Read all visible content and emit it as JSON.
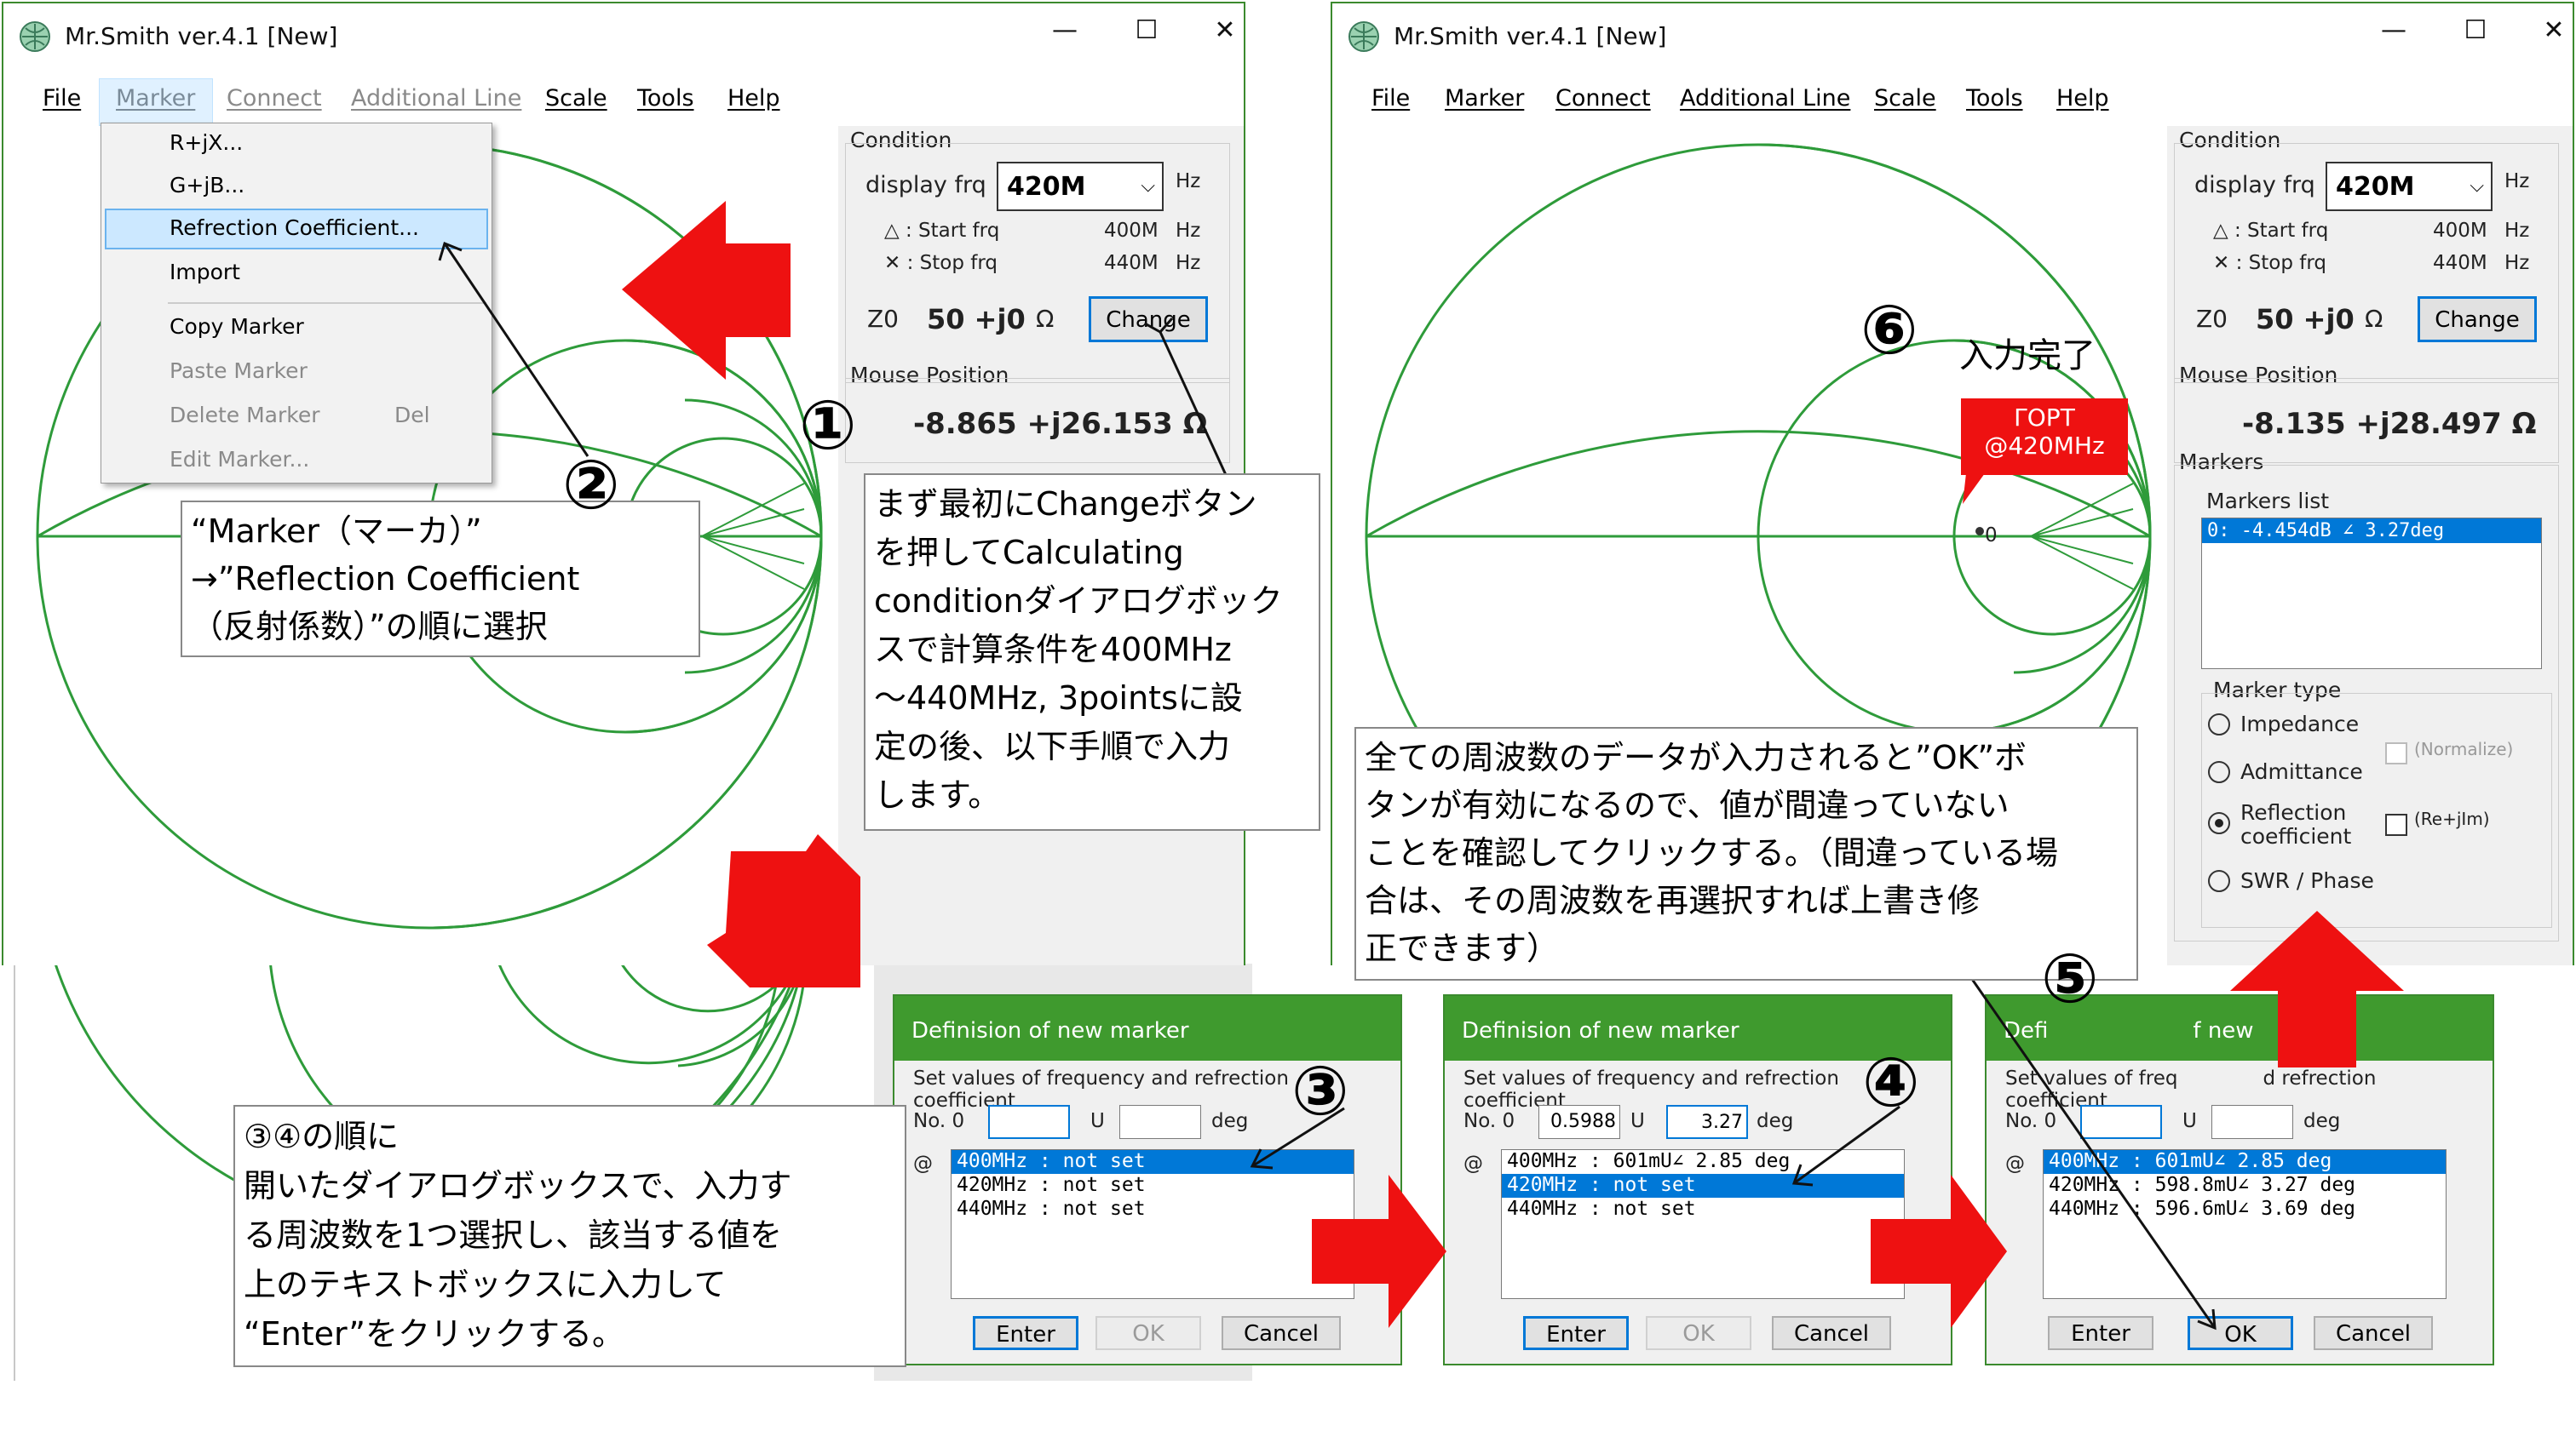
{
  "app": {
    "title": "Mr.Smith ver.4.1 [New]",
    "minimize": "—",
    "maximize": "☐",
    "close": "✕"
  },
  "menubar": {
    "file": "File",
    "marker": "Marker",
    "connect": "Connect",
    "additional_line": "Additional Line",
    "scale": "Scale",
    "tools": "Tools",
    "help": "Help"
  },
  "marker_menu": {
    "items": [
      "R+jX...",
      "G+jB...",
      "Refrection Coefficient...",
      "Import",
      "Copy Marker",
      "Paste Marker",
      "Delete Marker",
      "Edit Marker..."
    ],
    "delete_shortcut": "Del"
  },
  "condition": {
    "group": "Condition",
    "display_frq_label": "display frq",
    "display_frq_value": "420M",
    "hz": "Hz",
    "start_label": "△ : Start frq",
    "start_value": "400M",
    "stop_label": "✕ : Stop frq",
    "stop_value": "440M",
    "z0_label": "Z0",
    "z0_value": "50 +j0",
    "ohm": "Ω",
    "change": "Change"
  },
  "mouse": {
    "group": "Mouse Position",
    "value_left": "-8.865  +j26.153 Ω",
    "value_right": "-8.135  +j28.497 Ω"
  },
  "markers": {
    "group": "Markers",
    "list_label": "Markers list",
    "list_item": "0: -4.454dB ∠  3.27deg",
    "type_label": "Marker type",
    "impedance": "Impedance",
    "admittance": "Admittance",
    "reflection": "Reflection",
    "coefficient": "coefficient",
    "swr": "SWR / Phase",
    "normalize": "(Normalize)",
    "reim": "(Re+jIm)"
  },
  "smith": {
    "marker_label": "0",
    "gamma_label": "ΓOPT",
    "gamma_freq": "@420MHz"
  },
  "dialog": {
    "title": "Definision of new marker",
    "title_partial": "Defi",
    "title_partial2": "f new",
    "desc1": "Set values of frequency and refrection",
    "desc2": "coefficient",
    "desc_partial": "Set values of freq",
    "desc_partial2": "d refrection",
    "no_label": "No. 0",
    "u_label": "U",
    "deg_label": "deg",
    "at_label": "@",
    "enter": "Enter",
    "ok": "OK",
    "cancel": "Cancel",
    "d1": {
      "items": [
        "400MHz : not set",
        "420MHz : not set",
        "440MHz : not set"
      ],
      "u": "",
      "deg": ""
    },
    "d2": {
      "items": [
        "400MHz : 601mU∠ 2.85 deg",
        "420MHz : not set",
        "440MHz : not set"
      ],
      "u": "0.5988",
      "deg": "3.27"
    },
    "d3": {
      "items": [
        "400MHz : 601mU∠ 2.85 deg",
        "420MHz : 598.8mU∠ 3.27 deg",
        "440MHz : 596.6mU∠ 3.69 deg"
      ],
      "u": "",
      "deg": ""
    }
  },
  "annotations": {
    "n1": "①",
    "n2": "②",
    "n3": "③",
    "n4": "④",
    "n5": "⑤",
    "n6": "⑥",
    "c1": [
      "まず最初にChangeボタン",
      "を押してCalculating",
      "conditionダイアログボック",
      "スで計算条件を400MHz",
      "～440MHz, 3pointsに設",
      "定の後、以下手順で入力",
      "します。"
    ],
    "c2": [
      "“Marker（マーカ）”",
      "→”Reflection Coefficient",
      "（反射係数）”の順に選択"
    ],
    "c3": [
      "③④の順に",
      "開いたダイアログボックスで、入力す",
      "る周波数を1つ選択し、該当する値を",
      "上のテキストボックスに入力して",
      "“Enter”をクリックする。"
    ],
    "c5": [
      "全ての周波数のデータが入力されると”OK”ボ",
      "タンが有効になるので、値が間違っていない",
      "ことを確認してクリックする。（間違っている場",
      "合は、その周波数を再選択すれば上書き修",
      "正できます）"
    ],
    "c6": "入力完了"
  },
  "colors": {
    "accent_green": "#3f9a2e",
    "smith_green": "#2e9b3a",
    "arrow_red": "#ee1111",
    "select_blue": "#0078d7"
  }
}
